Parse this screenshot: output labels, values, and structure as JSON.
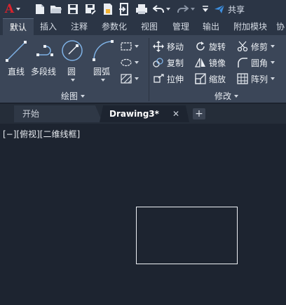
{
  "quick_access": {
    "logo": "A",
    "share_label": "共享",
    "icons": [
      "autocad-logo-icon",
      "new-file-icon",
      "open-folder-icon",
      "save-icon",
      "save-as-icon",
      "publish-icon",
      "import-icon",
      "plot-icon",
      "undo-icon",
      "redo-icon",
      "customize-dropdown-icon",
      "share-icon"
    ]
  },
  "ribbon_tabs": [
    "默认",
    "插入",
    "注释",
    "参数化",
    "视图",
    "管理",
    "输出",
    "附加模块",
    "协"
  ],
  "active_tab": "默认",
  "draw_panel": {
    "title": "绘图",
    "tools": {
      "line": "直线",
      "polyline": "多段线",
      "circle": "圆",
      "arc": "圆弧"
    }
  },
  "modify_panel": {
    "title": "修改",
    "tools": {
      "move": "移动",
      "rotate": "旋转",
      "trim": "修剪",
      "copy": "复制",
      "mirror": "镜像",
      "fillet": "圆角",
      "stretch": "拉伸",
      "scale": "缩放",
      "array": "阵列"
    }
  },
  "file_tabs": {
    "start": "开始",
    "document": "Drawing3*",
    "close": "✕",
    "new_tab": "+"
  },
  "viewport": {
    "label": "[−][俯视][二维线框]"
  },
  "colors": {
    "background": "#1d2430",
    "ribbon": "#3b4658",
    "logo_red": "#d9232d",
    "share_blue": "#3d8fe0"
  }
}
